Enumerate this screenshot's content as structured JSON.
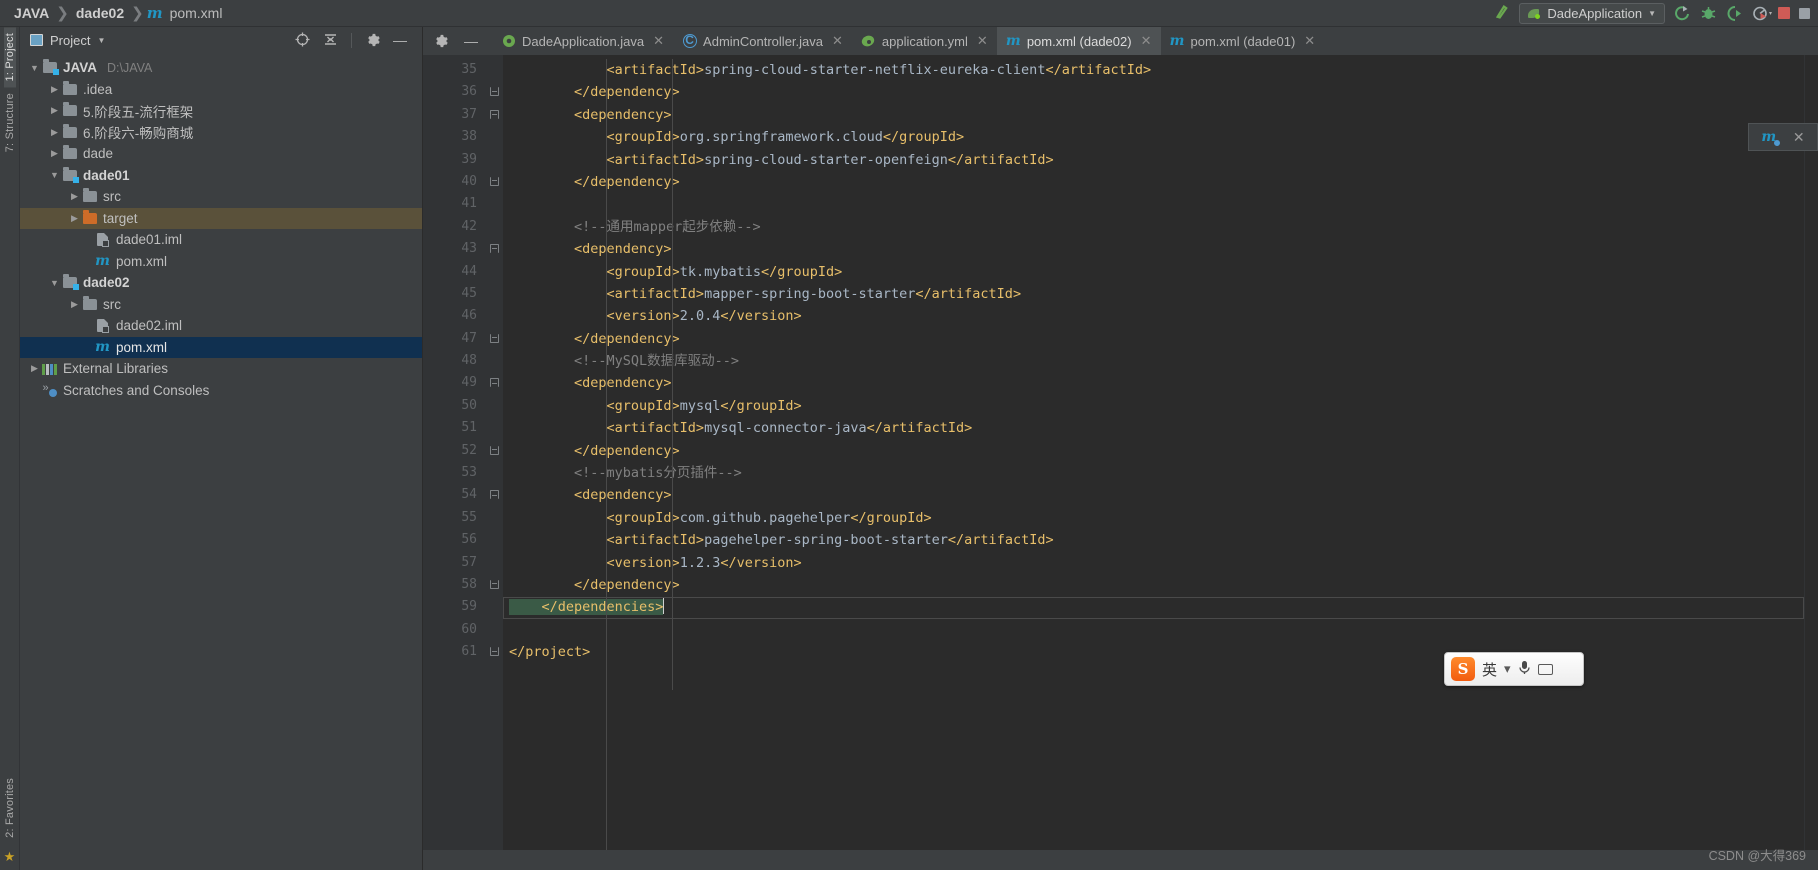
{
  "window": {
    "breadcrumb": [
      {
        "label": "JAVA",
        "icon": "none"
      },
      {
        "label": "dade02",
        "icon": "none"
      },
      {
        "label": "pom.xml",
        "icon": "maven-icon"
      }
    ],
    "run_configuration": "DadeApplication",
    "toolbar_icons": [
      "build-hammer-icon",
      "run-icon",
      "debug-icon",
      "run-with-coverage-icon",
      "profiler-icon",
      "stop-icon",
      "search-everywhere-icon"
    ]
  },
  "sidebar": {
    "vertical_tabs": [
      {
        "label": "1: Project",
        "active": true
      },
      {
        "label": "7: Structure",
        "active": false
      },
      {
        "label": "2: Favorites",
        "active": false
      }
    ],
    "panel_title": "Project",
    "header_icons": [
      "locate-icon",
      "collapse-all-icon",
      "settings-gear-icon",
      "hide-icon"
    ],
    "tree": [
      {
        "indent": 0,
        "arrow": "down",
        "icon": "module-folder-icon",
        "label": "JAVA",
        "sub": "D:\\JAVA",
        "bold": true,
        "state": "normal"
      },
      {
        "indent": 1,
        "arrow": "right",
        "icon": "folder-icon",
        "label": ".idea",
        "sub": "",
        "bold": false,
        "state": "normal"
      },
      {
        "indent": 1,
        "arrow": "right",
        "icon": "folder-icon",
        "label": "5.阶段五-流行框架",
        "sub": "",
        "bold": false,
        "state": "normal"
      },
      {
        "indent": 1,
        "arrow": "right",
        "icon": "folder-icon",
        "label": "6.阶段六-畅购商城",
        "sub": "",
        "bold": false,
        "state": "normal"
      },
      {
        "indent": 1,
        "arrow": "right",
        "icon": "folder-icon",
        "label": "dade",
        "sub": "",
        "bold": false,
        "state": "normal"
      },
      {
        "indent": 1,
        "arrow": "down",
        "icon": "module-folder-icon",
        "label": "dade01",
        "sub": "",
        "bold": true,
        "state": "normal"
      },
      {
        "indent": 2,
        "arrow": "right",
        "icon": "folder-icon",
        "label": "src",
        "sub": "",
        "bold": false,
        "state": "normal"
      },
      {
        "indent": 2,
        "arrow": "right",
        "icon": "folder-excluded-icon",
        "label": "target",
        "sub": "",
        "bold": false,
        "state": "highlighted"
      },
      {
        "indent": 2,
        "arrow": "none",
        "icon": "iml-file-icon",
        "label": "dade01.iml",
        "sub": "",
        "bold": false,
        "state": "normal"
      },
      {
        "indent": 2,
        "arrow": "none",
        "icon": "maven-icon",
        "label": "pom.xml",
        "sub": "",
        "bold": false,
        "state": "normal"
      },
      {
        "indent": 1,
        "arrow": "down",
        "icon": "module-folder-icon",
        "label": "dade02",
        "sub": "",
        "bold": true,
        "state": "normal"
      },
      {
        "indent": 2,
        "arrow": "right",
        "icon": "folder-icon",
        "label": "src",
        "sub": "",
        "bold": false,
        "state": "normal"
      },
      {
        "indent": 2,
        "arrow": "none",
        "icon": "iml-file-icon",
        "label": "dade02.iml",
        "sub": "",
        "bold": false,
        "state": "normal"
      },
      {
        "indent": 2,
        "arrow": "none",
        "icon": "maven-icon",
        "label": "pom.xml",
        "sub": "",
        "bold": false,
        "state": "selected"
      },
      {
        "indent": 0,
        "arrow": "right",
        "icon": "external-libraries-icon",
        "label": "External Libraries",
        "sub": "",
        "bold": false,
        "state": "normal"
      },
      {
        "indent": 0,
        "arrow": "none",
        "icon": "scratches-icon",
        "label": "Scratches and Consoles",
        "sub": "",
        "bold": false,
        "state": "normal"
      }
    ]
  },
  "editor": {
    "tabs": [
      {
        "label": "DadeApplication.java",
        "icon": "spring-boot-icon",
        "active": false,
        "closable": true
      },
      {
        "label": "AdminController.java",
        "icon": "java-class-icon",
        "active": false,
        "closable": true
      },
      {
        "label": "application.yml",
        "icon": "spring-yml-icon",
        "active": false,
        "closable": true
      },
      {
        "label": "pom.xml (dade02)",
        "icon": "maven-icon",
        "active": true,
        "closable": true
      },
      {
        "label": "pom.xml (dade01)",
        "icon": "maven-icon",
        "active": false,
        "closable": true
      }
    ],
    "first_line_number": 35,
    "caret_line": 59,
    "selection": "</dependencies>",
    "lines": [
      {
        "n": 35,
        "fold": "none",
        "segments": [
          {
            "t": "tag",
            "s": "            <artifactId>"
          },
          {
            "t": "val",
            "s": "spring-cloud-starter-netflix-eureka-client"
          },
          {
            "t": "tag",
            "s": "</artifactId>"
          }
        ]
      },
      {
        "n": 36,
        "fold": "end",
        "segments": [
          {
            "t": "tag",
            "s": "        </dependency>"
          }
        ]
      },
      {
        "n": 37,
        "fold": "start",
        "segments": [
          {
            "t": "tag",
            "s": "        <dependency>"
          }
        ]
      },
      {
        "n": 38,
        "fold": "none",
        "segments": [
          {
            "t": "tag",
            "s": "            <groupId>"
          },
          {
            "t": "val",
            "s": "org.springframework.cloud"
          },
          {
            "t": "tag",
            "s": "</groupId>"
          }
        ]
      },
      {
        "n": 39,
        "fold": "none",
        "segments": [
          {
            "t": "tag",
            "s": "            <artifactId>"
          },
          {
            "t": "val",
            "s": "spring-cloud-starter-openfeign"
          },
          {
            "t": "tag",
            "s": "</artifactId>"
          }
        ]
      },
      {
        "n": 40,
        "fold": "end",
        "segments": [
          {
            "t": "tag",
            "s": "        </dependency>"
          }
        ]
      },
      {
        "n": 41,
        "fold": "none",
        "segments": []
      },
      {
        "n": 42,
        "fold": "none",
        "segments": [
          {
            "t": "cmt",
            "s": "        <!--通用mapper起步依赖-->"
          }
        ]
      },
      {
        "n": 43,
        "fold": "start",
        "segments": [
          {
            "t": "tag",
            "s": "        <dependency>"
          }
        ]
      },
      {
        "n": 44,
        "fold": "none",
        "segments": [
          {
            "t": "tag",
            "s": "            <groupId>"
          },
          {
            "t": "val",
            "s": "tk.mybatis"
          },
          {
            "t": "tag",
            "s": "</groupId>"
          }
        ]
      },
      {
        "n": 45,
        "fold": "none",
        "segments": [
          {
            "t": "tag",
            "s": "            <artifactId>"
          },
          {
            "t": "val",
            "s": "mapper-spring-boot-starter"
          },
          {
            "t": "tag",
            "s": "</artifactId>"
          }
        ]
      },
      {
        "n": 46,
        "fold": "none",
        "segments": [
          {
            "t": "tag",
            "s": "            <version>"
          },
          {
            "t": "val",
            "s": "2.0.4"
          },
          {
            "t": "tag",
            "s": "</version>"
          }
        ]
      },
      {
        "n": 47,
        "fold": "end",
        "segments": [
          {
            "t": "tag",
            "s": "        </dependency>"
          }
        ]
      },
      {
        "n": 48,
        "fold": "none",
        "segments": [
          {
            "t": "cmt",
            "s": "        <!--MySQL数据库驱动-->"
          }
        ]
      },
      {
        "n": 49,
        "fold": "start",
        "segments": [
          {
            "t": "tag",
            "s": "        <dependency>"
          }
        ]
      },
      {
        "n": 50,
        "fold": "none",
        "segments": [
          {
            "t": "tag",
            "s": "            <groupId>"
          },
          {
            "t": "val",
            "s": "mysql"
          },
          {
            "t": "tag",
            "s": "</groupId>"
          }
        ]
      },
      {
        "n": 51,
        "fold": "none",
        "segments": [
          {
            "t": "tag",
            "s": "            <artifactId>"
          },
          {
            "t": "val",
            "s": "mysql-connector-java"
          },
          {
            "t": "tag",
            "s": "</artifactId>"
          }
        ]
      },
      {
        "n": 52,
        "fold": "end",
        "segments": [
          {
            "t": "tag",
            "s": "        </dependency>"
          }
        ]
      },
      {
        "n": 53,
        "fold": "none",
        "segments": [
          {
            "t": "cmt",
            "s": "        <!--mybatis分页插件-->"
          }
        ]
      },
      {
        "n": 54,
        "fold": "start",
        "segments": [
          {
            "t": "tag",
            "s": "        <dependency>"
          }
        ]
      },
      {
        "n": 55,
        "fold": "none",
        "segments": [
          {
            "t": "tag",
            "s": "            <groupId>"
          },
          {
            "t": "val",
            "s": "com.github.pagehelper"
          },
          {
            "t": "tag",
            "s": "</groupId>"
          }
        ]
      },
      {
        "n": 56,
        "fold": "none",
        "segments": [
          {
            "t": "tag",
            "s": "            <artifactId>"
          },
          {
            "t": "val",
            "s": "pagehelper-spring-boot-starter"
          },
          {
            "t": "tag",
            "s": "</artifactId>"
          }
        ]
      },
      {
        "n": 57,
        "fold": "none",
        "segments": [
          {
            "t": "tag",
            "s": "            <version>"
          },
          {
            "t": "val",
            "s": "1.2.3"
          },
          {
            "t": "tag",
            "s": "</version>"
          }
        ]
      },
      {
        "n": 58,
        "fold": "end",
        "segments": [
          {
            "t": "tag",
            "s": "        </dependency>"
          }
        ]
      },
      {
        "n": 59,
        "fold": "none",
        "selected": true,
        "segments": [
          {
            "t": "tag",
            "s": "    </dependencies>"
          }
        ]
      },
      {
        "n": 60,
        "fold": "none",
        "segments": []
      },
      {
        "n": 61,
        "fold": "end",
        "segments": [
          {
            "t": "tag",
            "s": "</project>"
          }
        ]
      }
    ]
  },
  "notification_chip": {
    "icon": "maven-icon",
    "close": "×"
  },
  "ime": {
    "logo": "S",
    "lang": "英",
    "menu_caret": "▾",
    "mic": "mic-icon",
    "keyboard": "keyboard-icon"
  },
  "watermark": "CSDN @大得369",
  "colors": {
    "accent_blue": "#2196c4",
    "panel_bg": "#3c3f41",
    "editor_bg": "#2b2b2b",
    "gutter_bg": "#313335",
    "selection_blue": "#103050",
    "tag_yellow": "#e8bf6a",
    "value_blue": "#a9b7c6",
    "comment_gray": "#808080",
    "target_highlight": "#5a513a"
  }
}
